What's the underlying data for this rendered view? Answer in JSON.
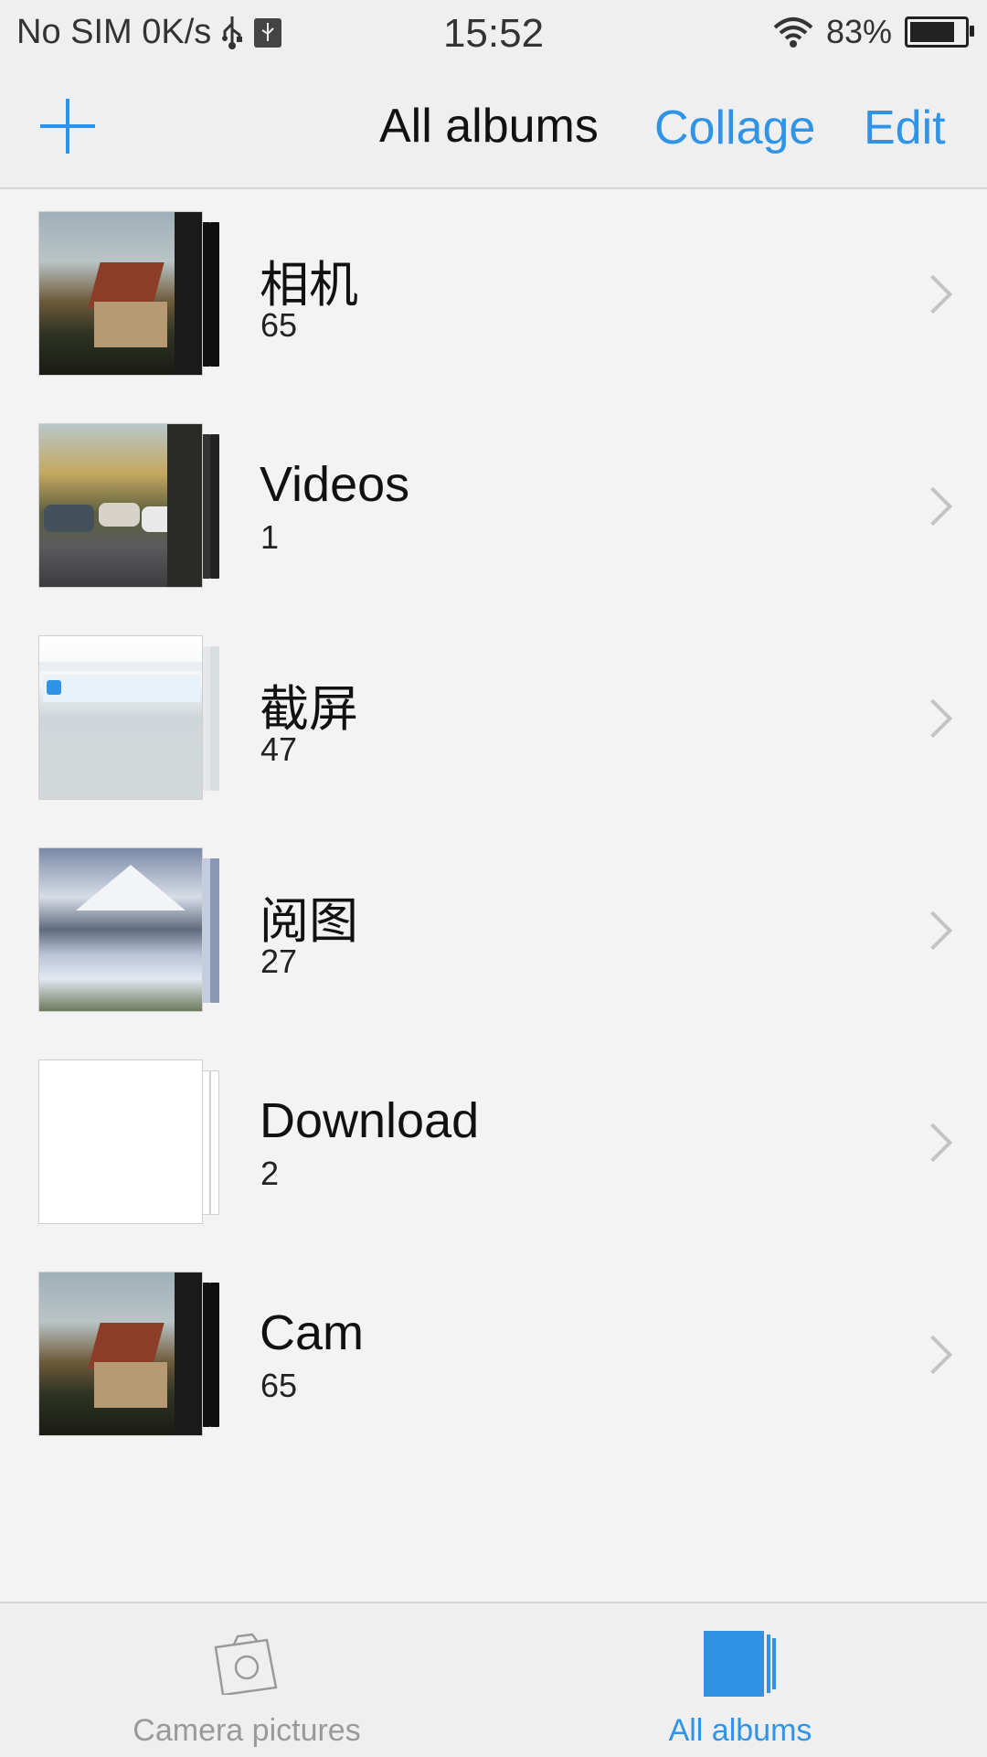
{
  "status_bar": {
    "left_text": "No SIM 0K/s",
    "time": "15:52",
    "battery": "83%",
    "battery_level": 0.83
  },
  "header": {
    "add_icon": "plus-icon",
    "title": "All albums",
    "collage_label": "Collage",
    "edit_label": "Edit"
  },
  "albums": [
    {
      "name": "相机",
      "count": "65",
      "thumb": "house"
    },
    {
      "name": "Videos",
      "count": "1",
      "thumb": "street"
    },
    {
      "name": "截屏",
      "count": "47",
      "thumb": "screenshot"
    },
    {
      "name": "阅图",
      "count": "27",
      "thumb": "mountain"
    },
    {
      "name": "Download",
      "count": "2",
      "thumb": "blank"
    },
    {
      "name": "Cam",
      "count": "65",
      "thumb": "house"
    }
  ],
  "tabs": [
    {
      "label": "Camera pictures",
      "icon": "camera-icon",
      "active": false
    },
    {
      "label": "All albums",
      "icon": "albums-icon",
      "active": true
    }
  ],
  "colors": {
    "accent": "#2f93e8",
    "background": "#f3f3f3",
    "inactive_tab": "#9a9a9a"
  }
}
